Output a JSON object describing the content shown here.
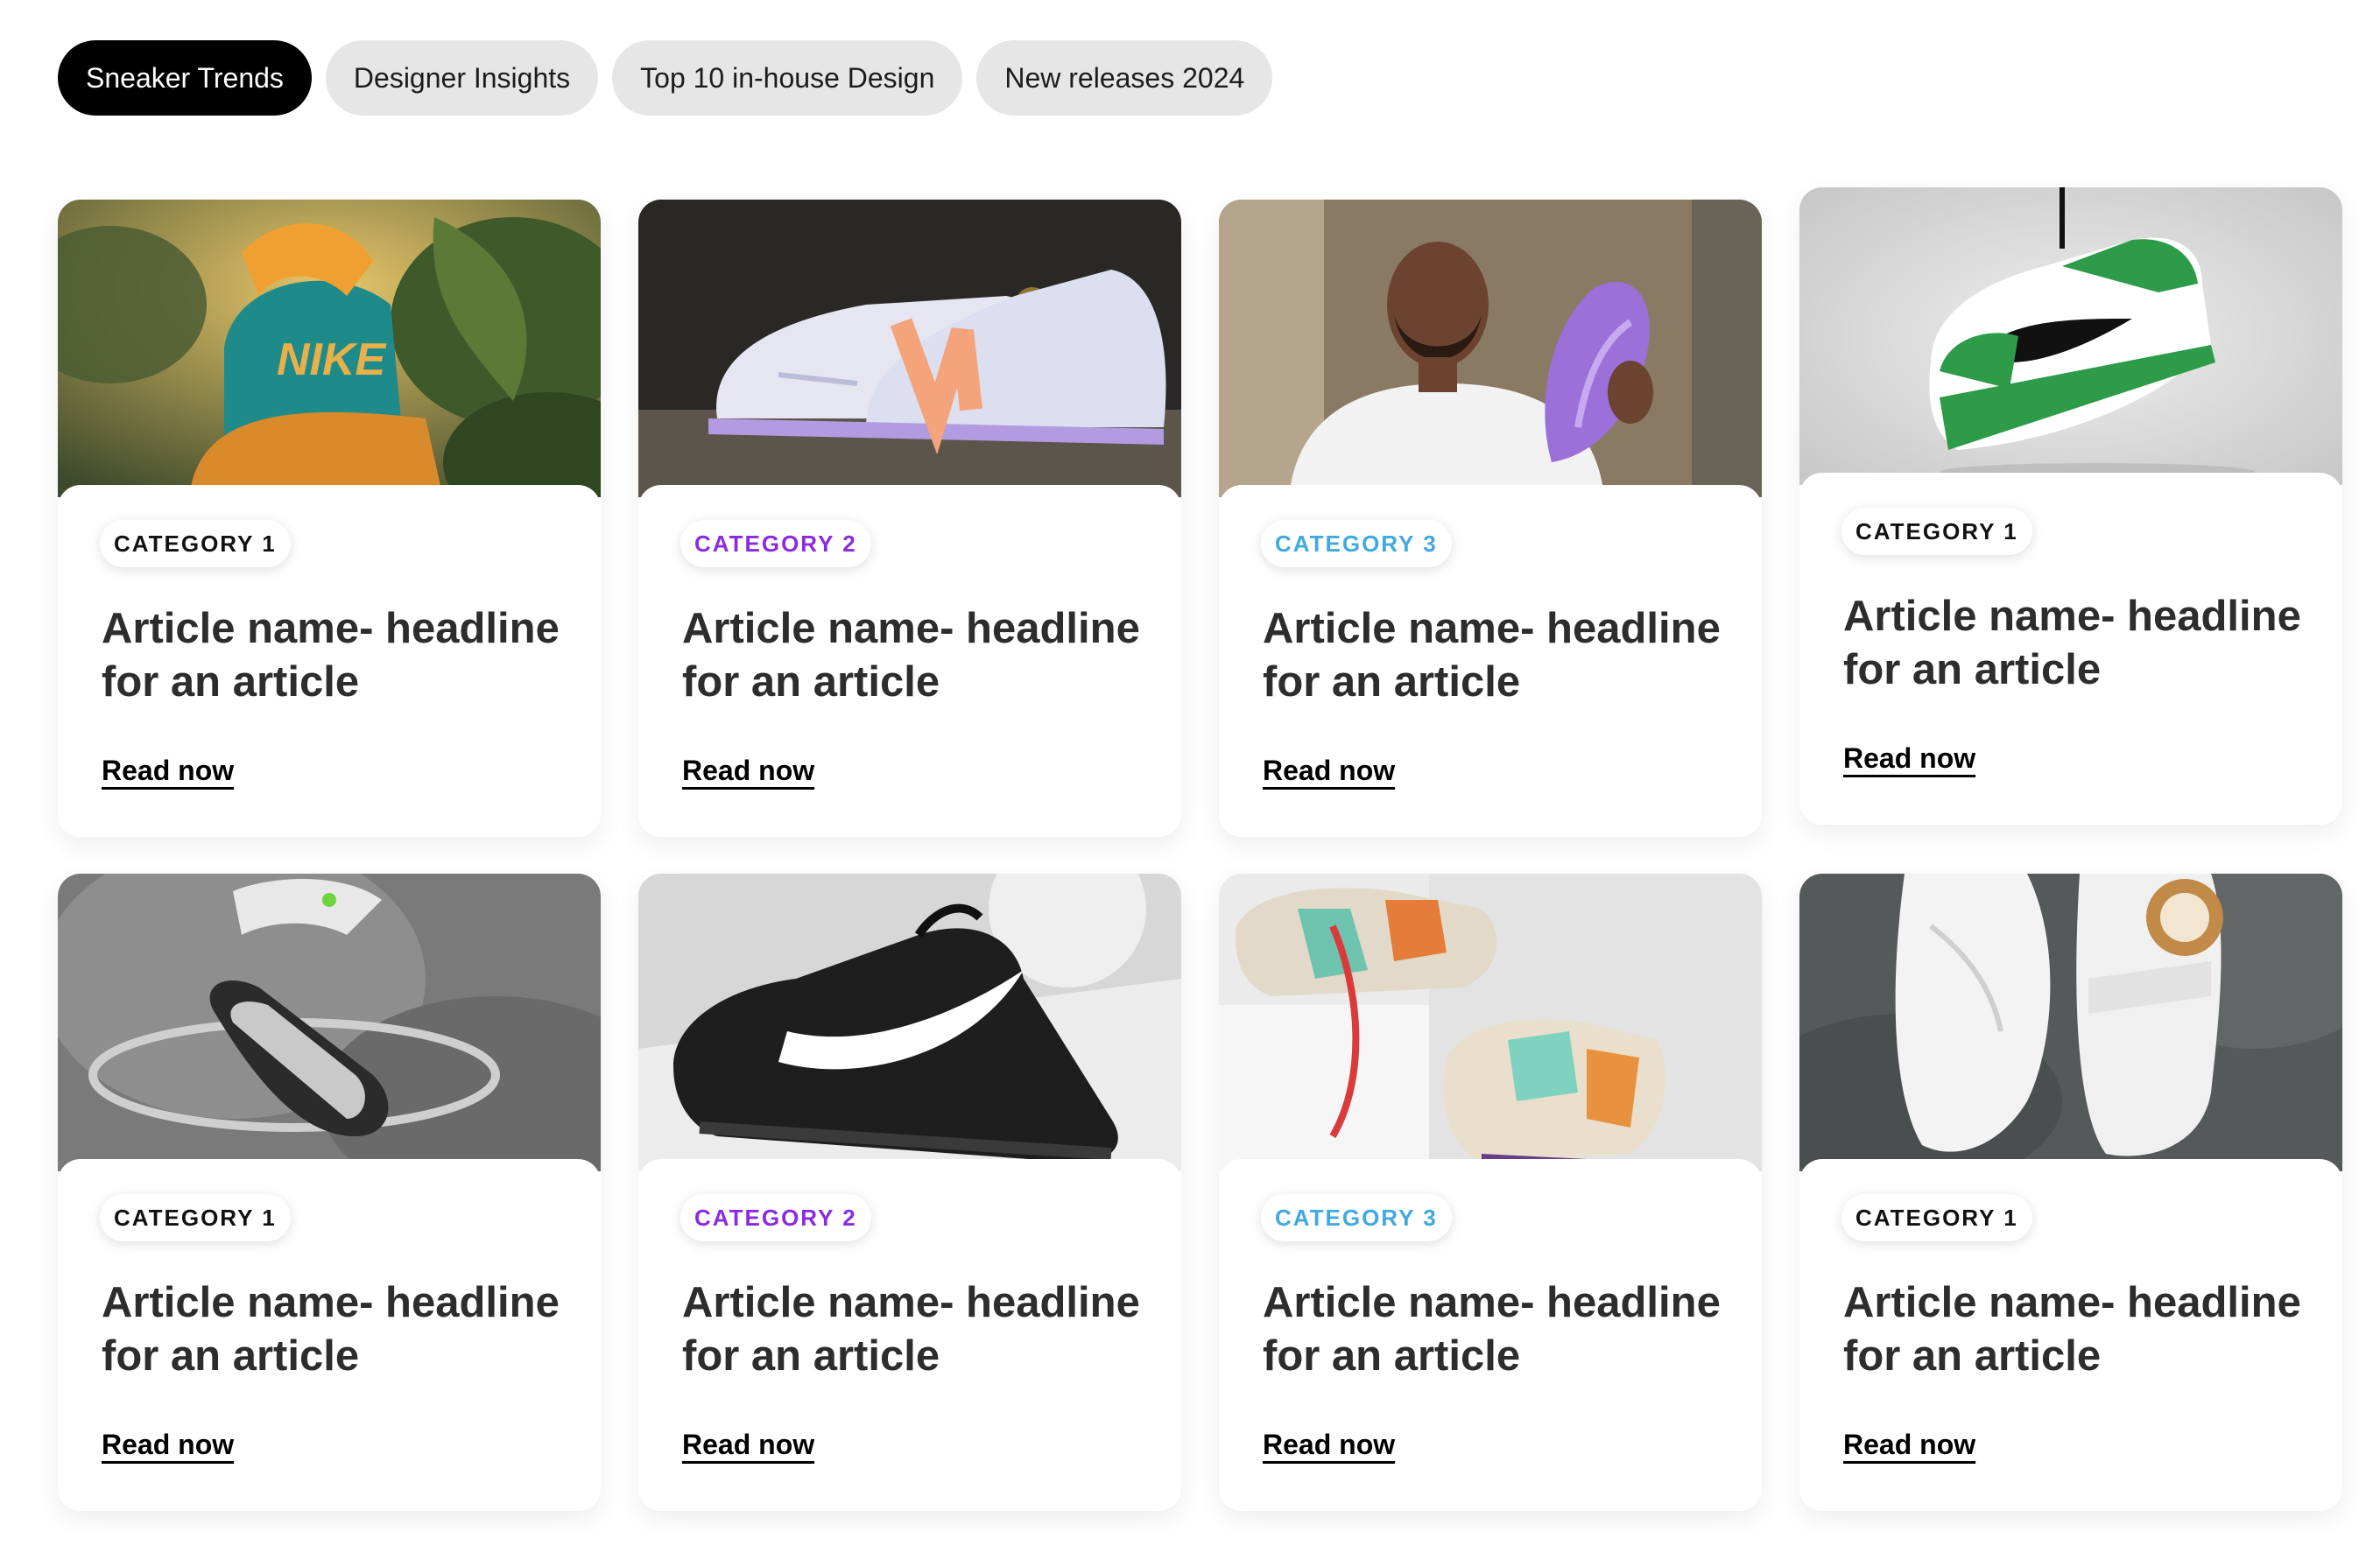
{
  "tabs": [
    {
      "label": "Sneaker Trends",
      "active": true
    },
    {
      "label": "Designer Insights",
      "active": false
    },
    {
      "label": "Top 10 in-house Design",
      "active": false
    },
    {
      "label": "New releases 2024",
      "active": false
    }
  ],
  "colors": {
    "category_1": "#111111",
    "category_2": "#8a2be2",
    "category_3": "#42a9df",
    "active_tab_bg": "#000000",
    "tab_bg": "#e6e6e6"
  },
  "articles": [
    {
      "category": "CATEGORY 1",
      "category_color": "#111111",
      "title": "Article name- headline for an article",
      "cta": "Read now",
      "image": "nike-orange-teal-sneaker-in-leaves"
    },
    {
      "category": "CATEGORY 2",
      "category_color": "#8a2be2",
      "title": "Article name- headline for an article",
      "cta": "Read now",
      "image": "new-balance-lavender-sneakers-on-pavement"
    },
    {
      "category": "CATEGORY 3",
      "category_color": "#42a9df",
      "title": "Article name- headline for an article",
      "cta": "Read now",
      "image": "man-holding-purple-sneaker"
    },
    {
      "category": "CATEGORY 1",
      "category_color": "#111111",
      "title": "Article name- headline for an article",
      "cta": "Read now",
      "image": "green-jordan-sneaker-hanging"
    },
    {
      "category": "CATEGORY 1",
      "category_color": "#111111",
      "title": "Article name- headline for an article",
      "cta": "Read now",
      "image": "jordan-sneakers-floating-with-ring"
    },
    {
      "category": "CATEGORY 2",
      "category_color": "#8a2be2",
      "title": "Article name- headline for an article",
      "cta": "Read now",
      "image": "black-nike-air-force-1"
    },
    {
      "category": "CATEGORY 3",
      "category_color": "#42a9df",
      "title": "Article name- headline for an article",
      "cta": "Read now",
      "image": "colorful-chunky-sneakers-on-blocks"
    },
    {
      "category": "CATEGORY 1",
      "category_color": "#111111",
      "title": "Article name- headline for an article",
      "cta": "Read now",
      "image": "white-high-top-sneakers-on-concrete"
    }
  ]
}
